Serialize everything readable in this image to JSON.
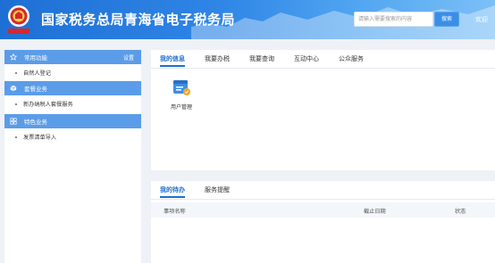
{
  "header": {
    "site_title": "国家税务总局青海省电子税务局",
    "search_placeholder": "请输入需要搜索的内容",
    "search_button": "搜索",
    "welcome": "欢迎"
  },
  "sidebar": {
    "common": {
      "title": "常用功能",
      "settings": "设置",
      "items": [
        "自然人登记"
      ]
    },
    "package": {
      "title": "套餐业务",
      "items": [
        "新办纳税人套餐服务"
      ]
    },
    "special": {
      "title": "特色业务",
      "items": [
        "发票清单导入"
      ]
    }
  },
  "main": {
    "tabs": [
      "我的信息",
      "我要办税",
      "我要查询",
      "互动中心",
      "公众服务"
    ],
    "active_tab": "我的信息",
    "apps": [
      {
        "label": "用户管理",
        "icon": "user-management-icon"
      }
    ]
  },
  "todo": {
    "tabs": [
      "我的待办",
      "服务提醒"
    ],
    "columns": [
      "事项名称",
      "截止日期",
      "状态"
    ]
  },
  "colors": {
    "header_blue": "#1e6fd4",
    "section_blue": "#5b9ce8",
    "active_tab": "#1d6fd1",
    "app_icon_blue": "#3d8fe8",
    "app_icon_orange": "#f4a623"
  }
}
